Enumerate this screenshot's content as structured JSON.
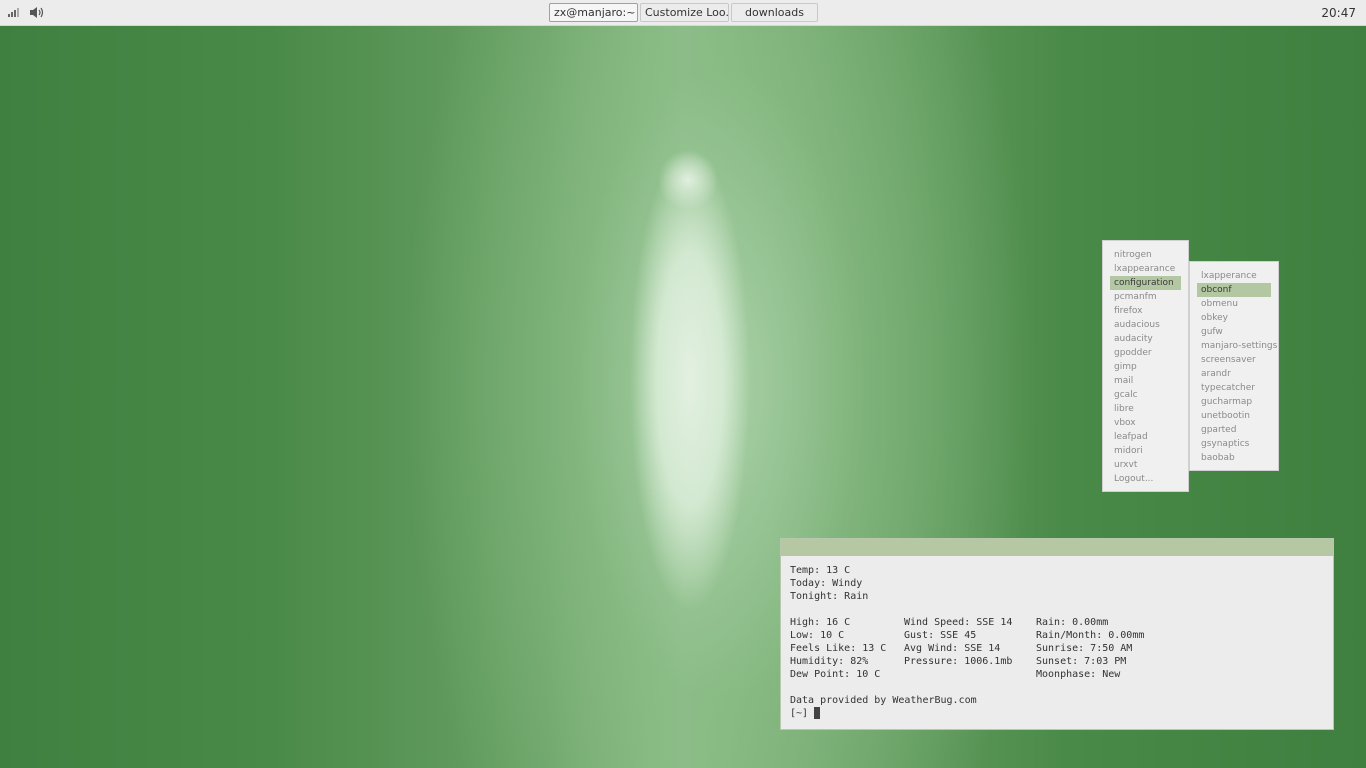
{
  "panel": {
    "tasks": [
      {
        "label": "zx@manjaro:~"
      },
      {
        "label": "Customize Loo..."
      },
      {
        "label": "downloads"
      }
    ],
    "clock": "20:47",
    "tray": {
      "network_icon": "network-signal-icon",
      "volume_icon": "volume-icon"
    }
  },
  "menu": {
    "items": [
      "nitrogen",
      "lxappearance",
      "configuration",
      "pcmanfm",
      "firefox",
      "audacious",
      "audacity",
      "gpodder",
      "gimp",
      "mail",
      "gcalc",
      "libre",
      "vbox",
      "leafpad",
      "midori",
      "urxvt",
      "Logout..."
    ],
    "selected": "configuration"
  },
  "submenu": {
    "items": [
      "lxapperance",
      "obconf",
      "obmenu",
      "obkey",
      "gufw",
      "manjaro-settings",
      "screensaver",
      "arandr",
      "typecatcher",
      "gucharmap",
      "unetbootin",
      "gparted",
      "gsynaptics",
      "baobab"
    ],
    "selected": "obconf"
  },
  "terminal": {
    "temp": "Temp: 13 C",
    "today": "Today: Windy",
    "tonight": "Tonight: Rain",
    "col1": [
      "High: 16 C",
      "Low: 10 C",
      "Feels Like: 13 C",
      "Humidity: 82%",
      "Dew Point: 10 C"
    ],
    "col2": [
      "Wind Speed: SSE 14",
      "Gust: SSE 45",
      "Avg Wind: SSE 14",
      "Pressure: 1006.1mb"
    ],
    "col3": [
      "Rain: 0.00mm",
      "Rain/Month: 0.00mm",
      "Sunrise: 7:50 AM",
      "Sunset: 7:03 PM",
      "Moonphase: New"
    ],
    "source": "Data provided by WeatherBug.com",
    "prompt": "[~]"
  },
  "colors": {
    "accent": "#b2c7a2",
    "panel": "#ececec",
    "terminal_bg": "#ececec"
  }
}
